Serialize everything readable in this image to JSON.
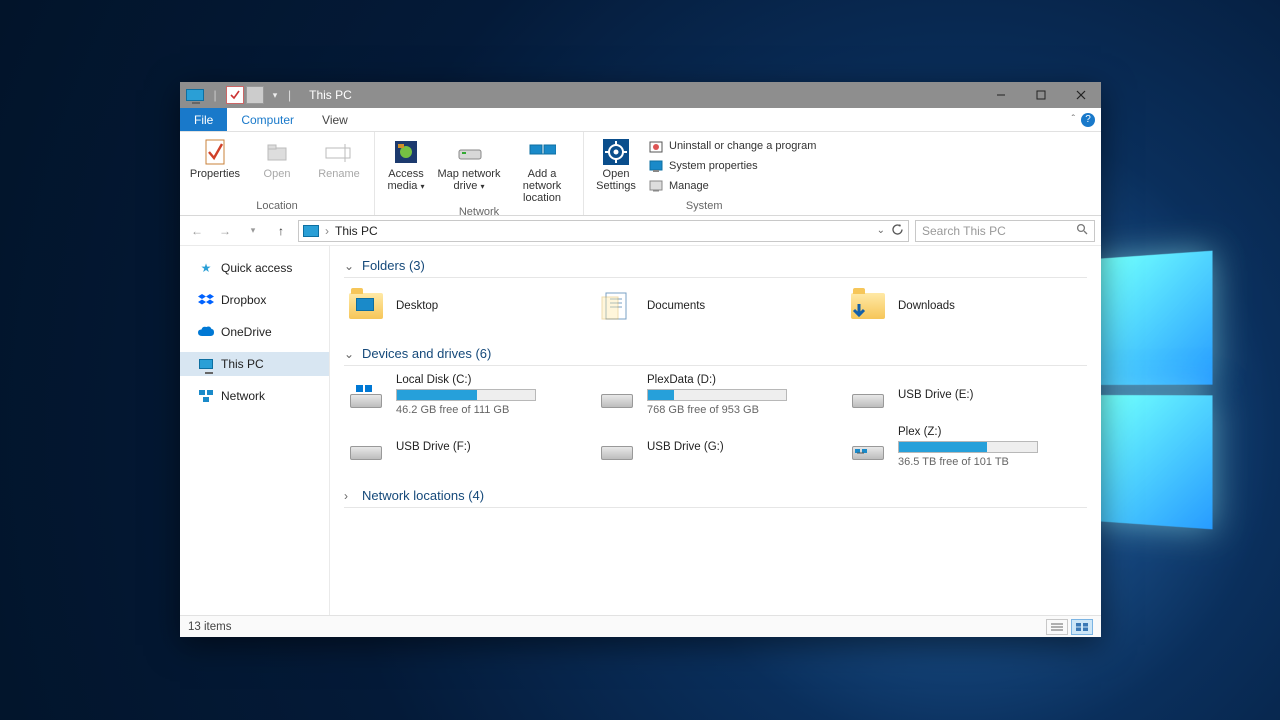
{
  "titlebar": {
    "title": "This PC"
  },
  "ribbon_tabs": {
    "file": "File",
    "computer": "Computer",
    "view": "View"
  },
  "ribbon": {
    "location": {
      "label": "Location",
      "properties": "Properties",
      "open": "Open",
      "rename": "Rename"
    },
    "network": {
      "label": "Network",
      "access_media": "Access media",
      "map_drive": "Map network drive",
      "add_location": "Add a network location"
    },
    "system": {
      "label": "System",
      "open_settings": "Open Settings",
      "uninstall": "Uninstall or change a program",
      "properties": "System properties",
      "manage": "Manage"
    }
  },
  "nav": {
    "breadcrumb_sep": "›",
    "breadcrumb": "This PC",
    "search_placeholder": "Search This PC"
  },
  "sidebar": {
    "items": [
      {
        "label": "Quick access"
      },
      {
        "label": "Dropbox"
      },
      {
        "label": "OneDrive"
      },
      {
        "label": "This PC"
      },
      {
        "label": "Network"
      }
    ]
  },
  "groups": {
    "folders": {
      "title": "Folders (3)",
      "expanded": true
    },
    "drives": {
      "title": "Devices and drives (6)",
      "expanded": true
    },
    "netloc": {
      "title": "Network locations (4)",
      "expanded": false
    }
  },
  "folders": [
    {
      "name": "Desktop"
    },
    {
      "name": "Documents"
    },
    {
      "name": "Downloads"
    }
  ],
  "drives": [
    {
      "name": "Local Disk (C:)",
      "free": "46.2 GB free of 111 GB",
      "fill_pct": 58,
      "has_bar": true,
      "os": true
    },
    {
      "name": "PlexData (D:)",
      "free": "768 GB free of 953 GB",
      "fill_pct": 19,
      "has_bar": true
    },
    {
      "name": "USB Drive (E:)",
      "has_bar": false
    },
    {
      "name": "USB Drive (F:)",
      "has_bar": false
    },
    {
      "name": "USB Drive (G:)",
      "has_bar": false
    },
    {
      "name": "Plex (Z:)",
      "free": "36.5 TB free of 101 TB",
      "fill_pct": 64,
      "has_bar": true,
      "net": true
    }
  ],
  "statusbar": {
    "count": "13 items"
  }
}
